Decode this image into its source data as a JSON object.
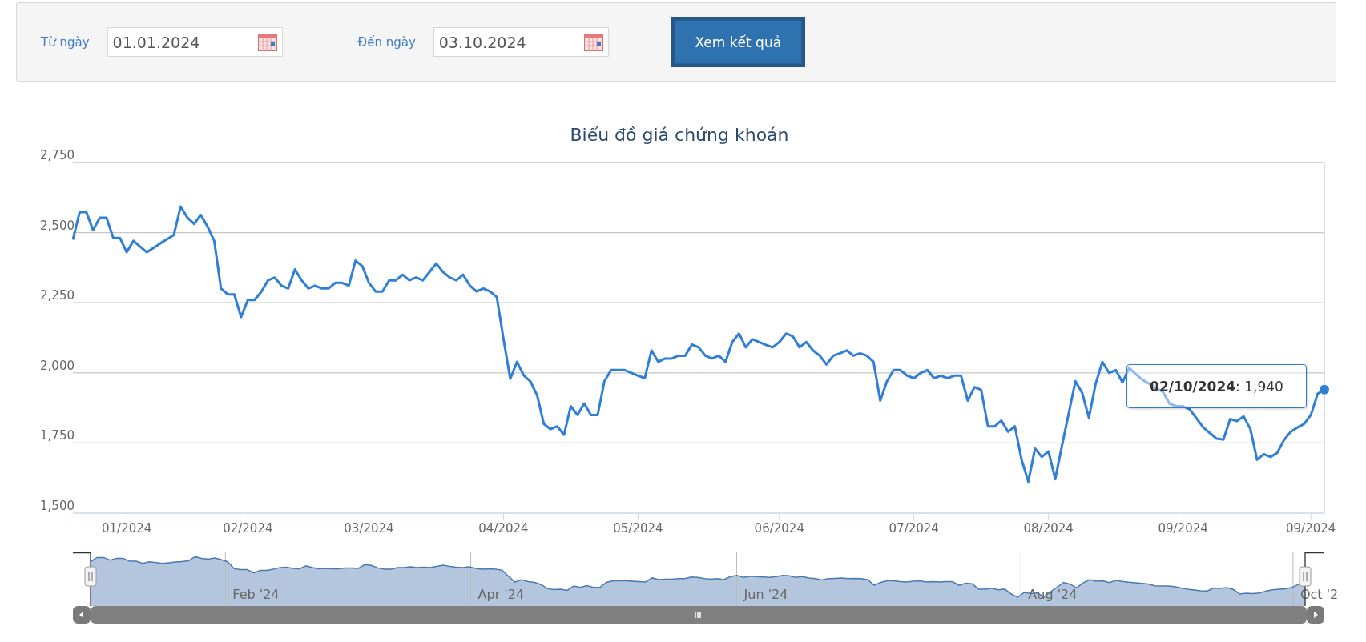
{
  "filter": {
    "from_label": "Từ ngày",
    "from_value": "01.01.2024",
    "to_label": "Đến ngày",
    "to_value": "03.10.2024",
    "submit": "Xem kết quả"
  },
  "chart": {
    "chart_data": {
      "type": "line",
      "title": "Biểu đồ giá chứng khoán",
      "grid": true,
      "ylim": [
        1500,
        2750
      ],
      "categories": [
        null,
        null,
        null,
        null,
        null,
        null,
        null,
        null,
        "01/2024",
        null,
        null,
        null,
        null,
        null,
        null,
        null,
        null,
        null,
        null,
        null,
        null,
        null,
        null,
        null,
        null,
        null,
        "02/2024",
        null,
        null,
        null,
        null,
        null,
        null,
        null,
        null,
        null,
        null,
        null,
        null,
        null,
        null,
        null,
        null,
        null,
        "03/2024",
        null,
        null,
        null,
        null,
        null,
        null,
        null,
        null,
        null,
        null,
        null,
        null,
        null,
        null,
        null,
        null,
        null,
        null,
        null,
        "04/2024",
        null,
        null,
        null,
        null,
        null,
        null,
        null,
        null,
        null,
        null,
        null,
        null,
        null,
        null,
        null,
        null,
        null,
        null,
        null,
        "05/2024",
        null,
        null,
        null,
        null,
        null,
        null,
        null,
        null,
        null,
        null,
        null,
        null,
        null,
        null,
        null,
        null,
        null,
        null,
        null,
        null,
        "06/2024",
        null,
        null,
        null,
        null,
        null,
        null,
        null,
        null,
        null,
        null,
        null,
        null,
        null,
        null,
        null,
        null,
        null,
        null,
        null,
        "07/2024",
        null,
        null,
        null,
        null,
        null,
        null,
        null,
        null,
        null,
        null,
        null,
        null,
        null,
        null,
        null,
        null,
        null,
        null,
        null,
        "08/2024",
        null,
        null,
        null,
        null,
        null,
        null,
        null,
        null,
        null,
        null,
        null,
        null,
        null,
        null,
        null,
        null,
        null,
        null,
        null,
        "09/2024",
        null,
        null,
        null,
        null,
        null,
        null,
        null,
        null,
        null,
        null,
        null,
        null,
        null,
        null,
        null,
        null,
        null,
        null,
        "09/2024",
        null,
        null
      ],
      "yticks": [
        {
          "value": 1500,
          "label": "1,500"
        },
        {
          "value": 1750,
          "label": "1,750"
        },
        {
          "value": 2000,
          "label": "2,000"
        },
        {
          "value": 2250,
          "label": "2,250"
        },
        {
          "value": 2500,
          "label": "2,500"
        },
        {
          "value": 2750,
          "label": "2,750"
        }
      ],
      "values": [
        2475,
        2573,
        2573,
        2509,
        2553,
        2553,
        2481,
        2481,
        2430,
        2471,
        2450,
        2430,
        2446,
        2462,
        2477,
        2492,
        2593,
        2554,
        2531,
        2563,
        2522,
        2471,
        2301,
        2280,
        2280,
        2199,
        2260,
        2260,
        2289,
        2330,
        2340,
        2311,
        2301,
        2369,
        2330,
        2301,
        2311,
        2301,
        2301,
        2321,
        2321,
        2311,
        2400,
        2381,
        2321,
        2290,
        2290,
        2330,
        2330,
        2350,
        2330,
        2340,
        2330,
        2360,
        2390,
        2360,
        2340,
        2330,
        2350,
        2311,
        2290,
        2301,
        2290,
        2270,
        2120,
        1979,
        2039,
        1991,
        1969,
        1919,
        1818,
        1799,
        1809,
        1779,
        1881,
        1850,
        1891,
        1850,
        1850,
        1970,
        2010,
        2010,
        2010,
        2000,
        1990,
        1981,
        2080,
        2039,
        2051,
        2051,
        2061,
        2061,
        2101,
        2091,
        2061,
        2051,
        2061,
        2039,
        2110,
        2140,
        2091,
        2120,
        2110,
        2100,
        2091,
        2110,
        2140,
        2130,
        2091,
        2110,
        2080,
        2061,
        2030,
        2061,
        2070,
        2080,
        2061,
        2070,
        2061,
        2039,
        1901,
        1970,
        2010,
        2010,
        1990,
        1981,
        2000,
        2010,
        1981,
        1990,
        1981,
        1990,
        1990,
        1901,
        1949,
        1939,
        1809,
        1809,
        1830,
        1790,
        1809,
        1690,
        1612,
        1730,
        1700,
        1720,
        1621,
        1740,
        1855,
        1970,
        1929,
        1840,
        1960,
        2039,
        2000,
        2010,
        1966,
        2017,
        1995,
        1975,
        1960,
        1945,
        1932,
        1890,
        1881,
        1881,
        1870,
        1838,
        1806,
        1785,
        1765,
        1762,
        1835,
        1828,
        1845,
        1800,
        1690,
        1710,
        1700,
        1715,
        1760,
        1790,
        1805,
        1818,
        1850,
        1925,
        1940
      ]
    },
    "tooltip": {
      "text": "**02/10/2024**: 1,940"
    }
  },
  "navigator": {
    "labels": [
      "Feb '24",
      "Apr '24",
      "Jun '24",
      "Aug '24",
      "Oct '2"
    ]
  }
}
